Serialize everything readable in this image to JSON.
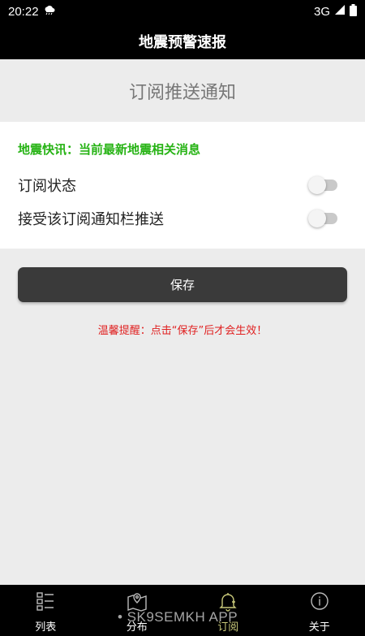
{
  "status_bar": {
    "time": "20:22",
    "network": "3G"
  },
  "header": {
    "title": "地震预警速报"
  },
  "section": {
    "title": "订阅推送通知"
  },
  "card": {
    "notice": "地震快讯：当前最新地震相关消息",
    "rows": [
      {
        "label": "订阅状态",
        "enabled": false
      },
      {
        "label": "接受该订阅通知栏推送",
        "enabled": false
      }
    ]
  },
  "save_button": {
    "label": "保存"
  },
  "tip": "温馨提醒：点击“保存”后才会生效！",
  "bottom_nav": {
    "items": [
      {
        "label": "列表",
        "icon": "list-icon"
      },
      {
        "label": "分布",
        "icon": "map-icon"
      },
      {
        "label": "订阅",
        "icon": "bell-icon",
        "active": true
      },
      {
        "label": "关于",
        "icon": "info-icon"
      }
    ]
  },
  "watermark": "• SK9SEMKH APP"
}
